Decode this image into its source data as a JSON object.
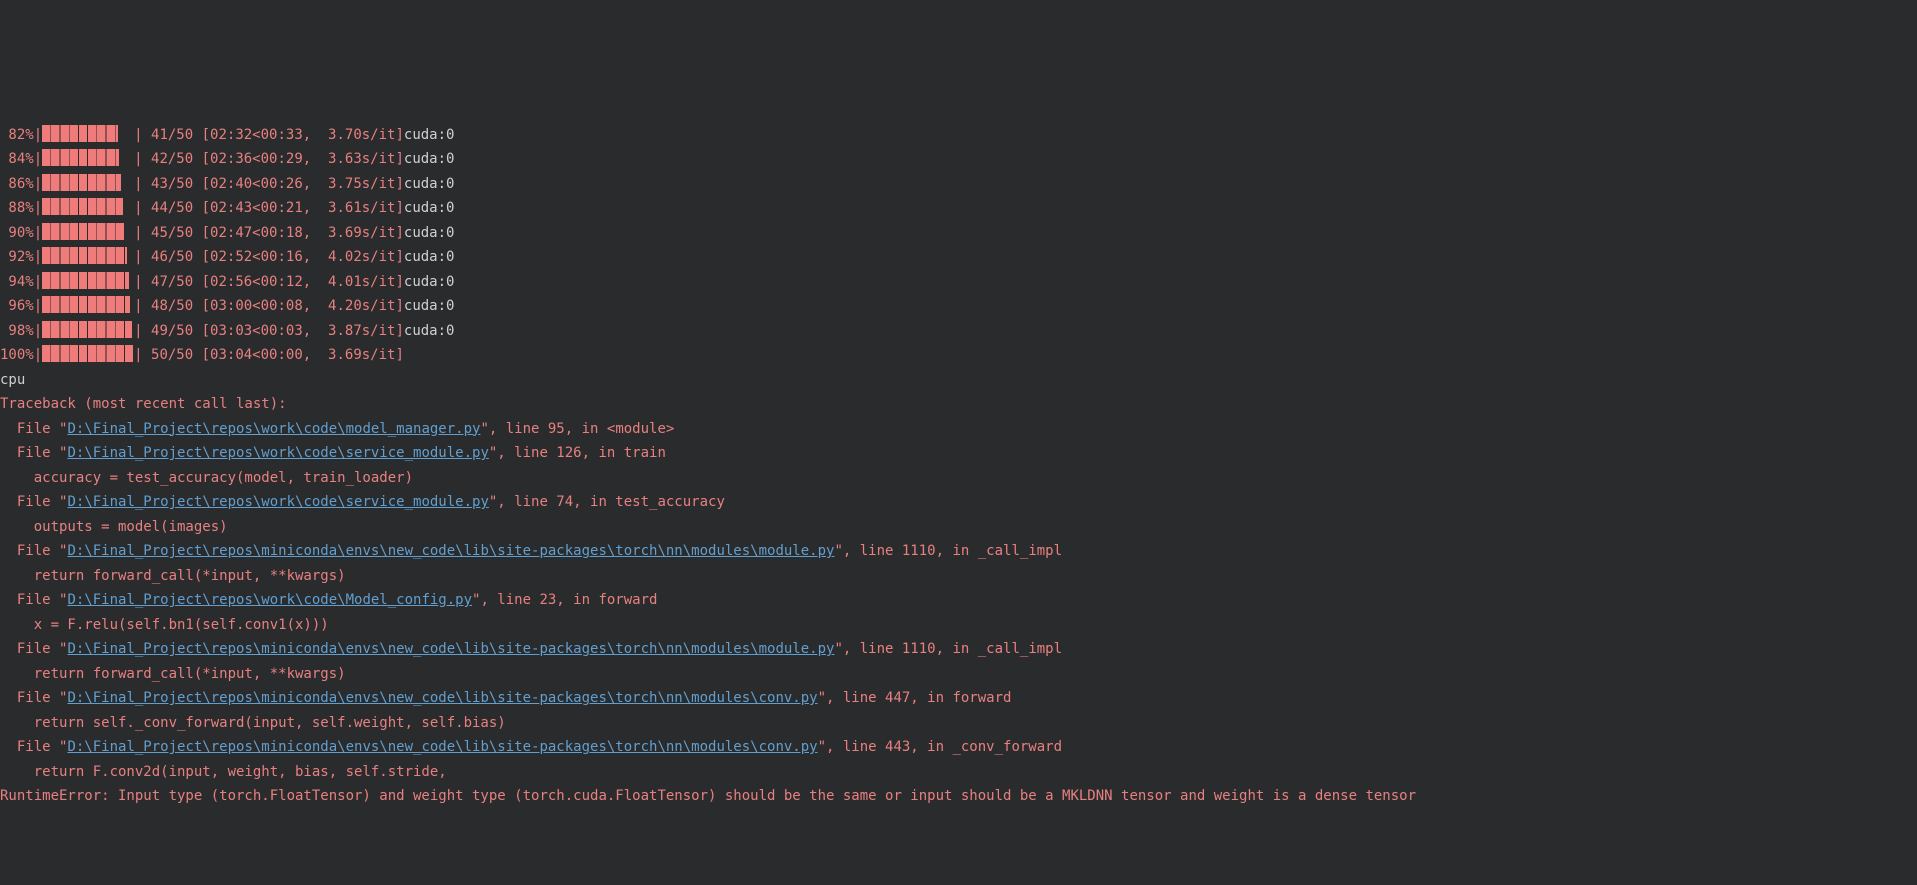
{
  "progress": [
    {
      "pct": "82%",
      "fill": 82,
      "iter": "41/50",
      "elapsed": "02:32",
      "remain": "00:33",
      "rate": "3.70s/it",
      "device": "cuda:0"
    },
    {
      "pct": "84%",
      "fill": 84,
      "iter": "42/50",
      "elapsed": "02:36",
      "remain": "00:29",
      "rate": "3.63s/it",
      "device": "cuda:0"
    },
    {
      "pct": "86%",
      "fill": 86,
      "iter": "43/50",
      "elapsed": "02:40",
      "remain": "00:26",
      "rate": "3.75s/it",
      "device": "cuda:0"
    },
    {
      "pct": "88%",
      "fill": 88,
      "iter": "44/50",
      "elapsed": "02:43",
      "remain": "00:21",
      "rate": "3.61s/it",
      "device": "cuda:0"
    },
    {
      "pct": "90%",
      "fill": 90,
      "iter": "45/50",
      "elapsed": "02:47",
      "remain": "00:18",
      "rate": "3.69s/it",
      "device": "cuda:0"
    },
    {
      "pct": "92%",
      "fill": 92,
      "iter": "46/50",
      "elapsed": "02:52",
      "remain": "00:16",
      "rate": "4.02s/it",
      "device": "cuda:0"
    },
    {
      "pct": "94%",
      "fill": 94,
      "iter": "47/50",
      "elapsed": "02:56",
      "remain": "00:12",
      "rate": "4.01s/it",
      "device": "cuda:0"
    },
    {
      "pct": "96%",
      "fill": 96,
      "iter": "48/50",
      "elapsed": "03:00",
      "remain": "00:08",
      "rate": "4.20s/it",
      "device": "cuda:0"
    },
    {
      "pct": "98%",
      "fill": 98,
      "iter": "49/50",
      "elapsed": "03:03",
      "remain": "00:03",
      "rate": "3.87s/it",
      "device": "cuda:0"
    },
    {
      "pct": "100%",
      "fill": 100,
      "iter": "50/50",
      "elapsed": "03:04",
      "remain": "00:00",
      "rate": "3.69s/it",
      "device": ""
    }
  ],
  "cpu_line": "cpu",
  "tb_header": "Traceback (most recent call last):",
  "frames": [
    {
      "path": "D:\\Final_Project\\repos\\work\\code\\model_manager.py",
      "line": "95",
      "func": "<module>",
      "code": null
    },
    {
      "path": "D:\\Final_Project\\repos\\work\\code\\service_module.py",
      "line": "126",
      "func": "train",
      "code": "accuracy = test_accuracy(model, train_loader)"
    },
    {
      "path": "D:\\Final_Project\\repos\\work\\code\\service_module.py",
      "line": "74",
      "func": "test_accuracy",
      "code": "outputs = model(images)"
    },
    {
      "path": "D:\\Final_Project\\repos\\miniconda\\envs\\new_code\\lib\\site-packages\\torch\\nn\\modules\\module.py",
      "line": "1110",
      "func": "_call_impl",
      "code": "return forward_call(*input, **kwargs)"
    },
    {
      "path": "D:\\Final_Project\\repos\\work\\code\\Model_config.py",
      "line": "23",
      "func": "forward",
      "code": "x = F.relu(self.bn1(self.conv1(x)))"
    },
    {
      "path": "D:\\Final_Project\\repos\\miniconda\\envs\\new_code\\lib\\site-packages\\torch\\nn\\modules\\module.py",
      "line": "1110",
      "func": "_call_impl",
      "code": "return forward_call(*input, **kwargs)"
    },
    {
      "path": "D:\\Final_Project\\repos\\miniconda\\envs\\new_code\\lib\\site-packages\\torch\\nn\\modules\\conv.py",
      "line": "447",
      "func": "forward",
      "code": "return self._conv_forward(input, self.weight, self.bias)"
    },
    {
      "path": "D:\\Final_Project\\repos\\miniconda\\envs\\new_code\\lib\\site-packages\\torch\\nn\\modules\\conv.py",
      "line": "443",
      "func": "_conv_forward",
      "code": "return F.conv2d(input, weight, bias, self.stride,"
    }
  ],
  "error": "RuntimeError: Input type (torch.FloatTensor) and weight type (torch.cuda.FloatTensor) should be the same or input should be a MKLDNN tensor and weight is a dense tensor",
  "labels": {
    "file_prefix": "  File \"",
    "line_prefix": "\", line ",
    "in_prefix": ", in "
  }
}
